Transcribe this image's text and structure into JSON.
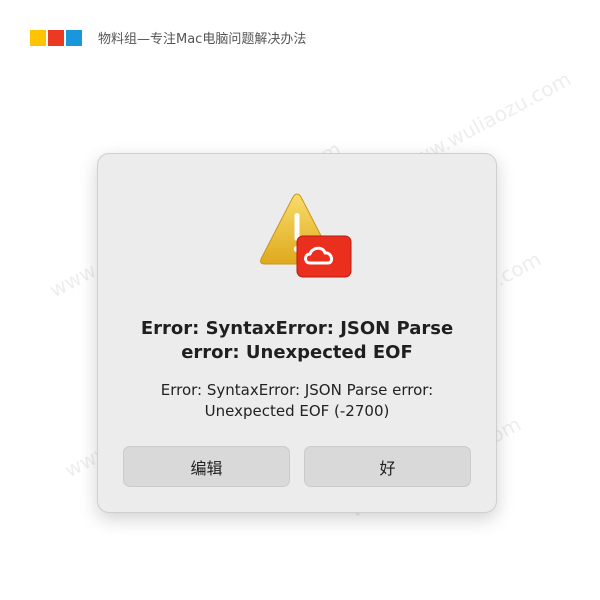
{
  "brand": {
    "text": "物料组—专注Mac电脑问题解决办法",
    "colors": [
      "#ffc400",
      "#ec3a22",
      "#1a97db"
    ]
  },
  "watermark": {
    "text": "www.wuliaozu.com"
  },
  "dialog": {
    "icon": "warning-triangle-icon",
    "app_badge_icon": "creative-cloud-icon",
    "title": "Error: SyntaxError: JSON Parse error: Unexpected EOF",
    "message": "Error: SyntaxError: JSON Parse error: Unexpected EOF (-2700)",
    "buttons": {
      "edit": "编辑",
      "ok": "好"
    }
  }
}
